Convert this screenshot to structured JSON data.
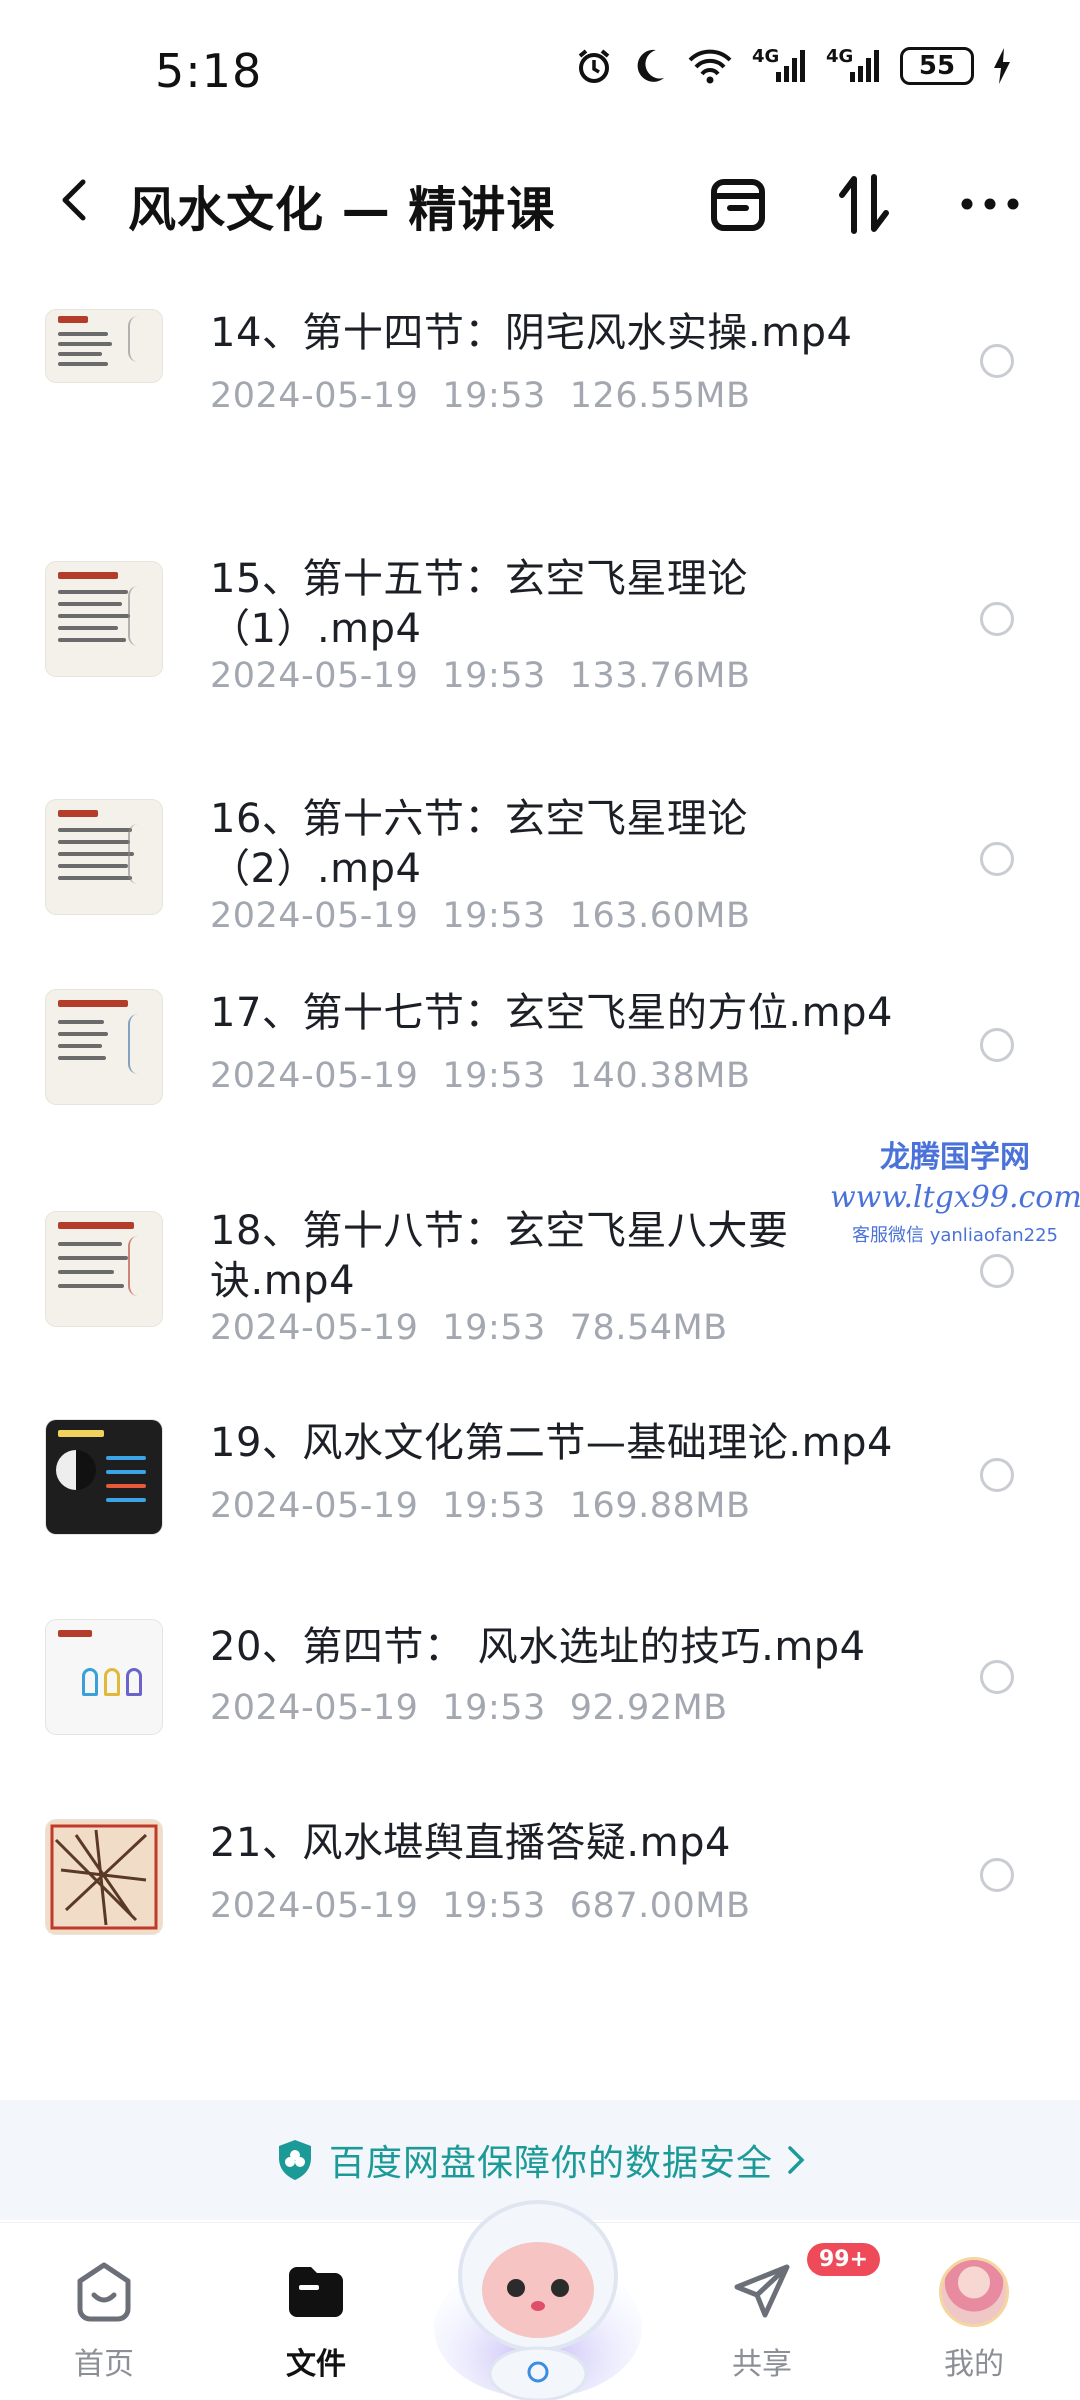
{
  "status": {
    "time": "5:18",
    "signal1": "4G",
    "signal2": "4G",
    "battery": "55"
  },
  "header": {
    "title": "风水文化 — 精讲课"
  },
  "files": [
    {
      "name": "14、第十四节：阴宅风水实操.mp4",
      "date": "2024-05-19",
      "time": "19:53",
      "size": "126.55MB"
    },
    {
      "name": "15、第十五节：玄空飞星理论（1）.mp4",
      "date": "2024-05-19",
      "time": "19:53",
      "size": "133.76MB"
    },
    {
      "name": "16、第十六节：玄空飞星理论（2）.mp4",
      "date": "2024-05-19",
      "time": "19:53",
      "size": "163.60MB"
    },
    {
      "name": "17、第十七节：玄空飞星的方位.mp4",
      "date": "2024-05-19",
      "time": "19:53",
      "size": "140.38MB"
    },
    {
      "name": "18、第十八节：玄空飞星八大要诀.mp4",
      "date": "2024-05-19",
      "time": "19:53",
      "size": "78.54MB"
    },
    {
      "name": "19、风水文化第二节—基础理论.mp4",
      "date": "2024-05-19",
      "time": "19:53",
      "size": "169.88MB"
    },
    {
      "name": "20、第四节： 风水选址的技巧.mp4",
      "date": "2024-05-19",
      "time": "19:53",
      "size": "92.92MB"
    },
    {
      "name": "21、风水堪舆直播答疑.mp4",
      "date": "2024-05-19",
      "time": "19:53",
      "size": "687.00MB"
    }
  ],
  "watermark": {
    "title": "龙腾国学网",
    "url": "www.ltgx99.com",
    "sub": "客服微信 yanliaofan225"
  },
  "banner": {
    "text": "百度网盘保障你的数据安全"
  },
  "nav": {
    "home": "首页",
    "files": "文件",
    "share": "共享",
    "share_badge": "99+",
    "mine": "我的"
  },
  "colors": {
    "accent": "#1b9a97",
    "badge": "#ef4a5a",
    "meta": "#a3a7b0"
  }
}
